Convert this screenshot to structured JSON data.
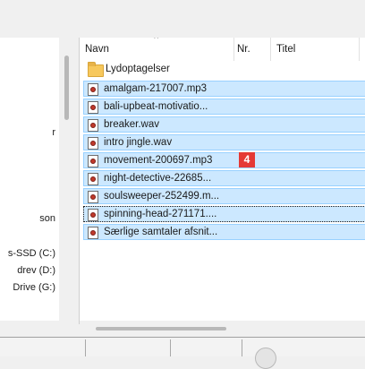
{
  "nav": {
    "items": [
      "r",
      "son",
      "s-SSD (C:)",
      "drev (D:)",
      "Drive (G:)"
    ]
  },
  "columns": {
    "name": "Navn",
    "number": "Nr.",
    "title": "Titel"
  },
  "folder": {
    "name": "Lydoptagelser"
  },
  "files": [
    "amalgam-217007.mp3",
    "bali-upbeat-motivatio...",
    "breaker.wav",
    "intro jingle.wav",
    "movement-200697.mp3",
    "night-detective-22685...",
    "soulsweeper-252499.m...",
    "spinning-head-271171....",
    "Særlige samtaler afsnit..."
  ],
  "badge": "4",
  "colors": {
    "selection_fill": "#cce8ff",
    "selection_border": "#99d1ff",
    "badge": "#e53935"
  }
}
